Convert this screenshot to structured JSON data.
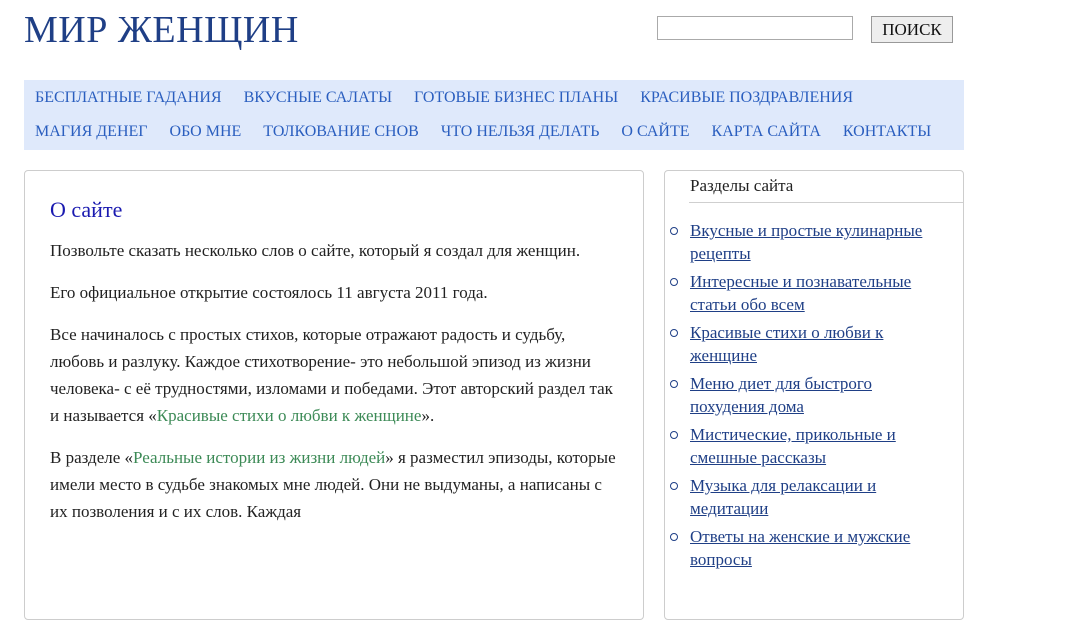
{
  "header": {
    "site_title": "МИР ЖЕНЩИН",
    "search_value": "",
    "search_button_label": "ПОИСК"
  },
  "nav": {
    "row1": [
      {
        "label": "БЕСПЛАТНЫЕ ГАДАНИЯ"
      },
      {
        "label": "ВКУСНЫЕ САЛАТЫ"
      },
      {
        "label": "ГОТОВЫЕ БИЗНЕС ПЛАНЫ"
      },
      {
        "label": "КРАСИВЫЕ ПОЗДРАВЛЕНИЯ"
      }
    ],
    "row2": [
      {
        "label": "МАГИЯ ДЕНЕГ"
      },
      {
        "label": "ОБО МНЕ"
      },
      {
        "label": "ТОЛКОВАНИЕ СНОВ"
      },
      {
        "label": "ЧТО НЕЛЬЗЯ ДЕЛАТЬ"
      },
      {
        "label": "О САЙТЕ"
      },
      {
        "label": "КАРТА САЙТА"
      },
      {
        "label": "КОНТАКТЫ"
      }
    ]
  },
  "main": {
    "heading": "О сайте",
    "p1": "Позвольте сказать несколько слов о сайте, который я создал для женщин.",
    "p2": "Его официальное открытие состоялось 11 августа 2011 года.",
    "p3_before": "Все начиналось с простых стихов, которые отражают радость и судьбу, любовь и разлуку. Каждое стихотворение- это небольшой эпизод из жизни человека- с её трудностями, изломами и победами. Этот авторский раздел так и называется «",
    "p3_link": "Красивые стихи о любви к женщине",
    "p3_after": "».",
    "p4_before": "В разделе «",
    "p4_link": "Реальные истории из жизни людей",
    "p4_after": "» я разместил эпизоды, которые имели место в судьбе знакомых мне людей. Они не выдуманы, а написаны с их позволения и с их слов. Каждая"
  },
  "sidebar": {
    "title": "Разделы сайта",
    "items": [
      {
        "label": "Вкусные и простые кулинарные рецепты"
      },
      {
        "label": "Интересные и познавательные статьи обо всем"
      },
      {
        "label": "Красивые стихи о любви к женщине"
      },
      {
        "label": "Меню диет для быстрого похудения дома"
      },
      {
        "label": "Мистические, прикольные и смешные рассказы"
      },
      {
        "label": "Музыка для релаксации и медитации"
      },
      {
        "label": "Ответы на женские и мужские вопросы"
      }
    ]
  },
  "colors": {
    "title": "#1f3f86",
    "nav_bg": "#dfe9fb",
    "nav_link": "#2a5ebf",
    "heading": "#1a1ab0",
    "inline_link": "#3c8a56"
  }
}
